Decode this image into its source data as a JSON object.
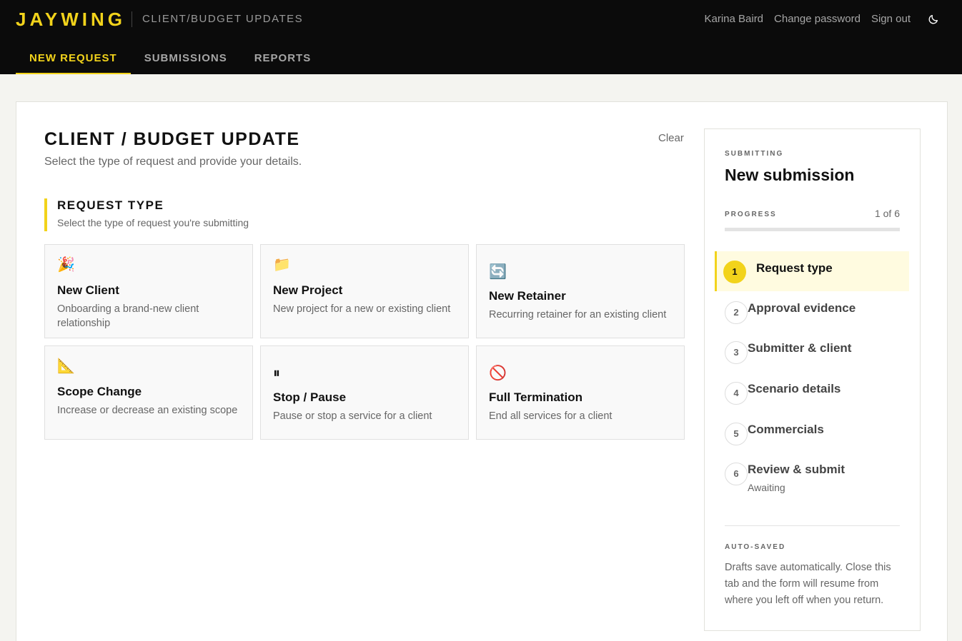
{
  "header": {
    "brand": "JAYWING",
    "app_title": "CLIENT/BUDGET UPDATES",
    "user_name": "Karina Baird",
    "change_password": "Change password",
    "sign_out": "Sign out",
    "theme_icon": "moon-icon"
  },
  "tabs": [
    {
      "label": "NEW REQUEST",
      "active": true
    },
    {
      "label": "SUBMISSIONS",
      "active": false
    },
    {
      "label": "REPORTS",
      "active": false
    }
  ],
  "form": {
    "title": "CLIENT / BUDGET UPDATE",
    "subtitle": "Select the type of request and provide your details.",
    "clear_label": "Clear",
    "section_title": "REQUEST TYPE",
    "section_subtitle": "Select the type of request you're submitting"
  },
  "request_types": [
    {
      "icon": "🎉",
      "icon_name": "party-popper-icon",
      "title": "New Client",
      "description": "Onboarding a brand-new client relationship"
    },
    {
      "icon": "📁",
      "icon_name": "folder-icon",
      "title": "New Project",
      "description": "New project for a new or existing client"
    },
    {
      "icon": "🔄",
      "icon_name": "refresh-icon",
      "title": "New Retainer",
      "description": "Recurring retainer for an existing client"
    },
    {
      "icon": "📐",
      "icon_name": "triangle-ruler-icon",
      "title": "Scope Change",
      "description": "Increase or decrease an existing scope"
    },
    {
      "icon": "⏸",
      "icon_name": "pause-icon",
      "title": "Stop / Pause",
      "description": "Pause or stop a service for a client"
    },
    {
      "icon": "🚫",
      "icon_name": "prohibited-icon",
      "title": "Full Termination",
      "description": "End all services for a client"
    }
  ],
  "sidebar": {
    "submitting_label": "SUBMITTING",
    "heading": "New submission",
    "progress_label": "PROGRESS",
    "progress_count": "1 of 6",
    "progress_fraction": 0,
    "steps": [
      {
        "number": "1",
        "label": "Request type",
        "note": ""
      },
      {
        "number": "2",
        "label": "Approval evidence",
        "note": ""
      },
      {
        "number": "3",
        "label": "Submitter & client",
        "note": ""
      },
      {
        "number": "4",
        "label": "Scenario details",
        "note": ""
      },
      {
        "number": "5",
        "label": "Commercials",
        "note": ""
      },
      {
        "number": "6",
        "label": "Review & submit",
        "note": "Awaiting"
      }
    ],
    "autosave_label": "AUTO-SAVED",
    "autosave_text": "Drafts save automatically. Close this tab and the form will resume from where you left off when you return."
  },
  "colors": {
    "accent": "#f2d31b",
    "header_bg": "#0b0b0b",
    "page_bg": "#f4f4f0"
  }
}
